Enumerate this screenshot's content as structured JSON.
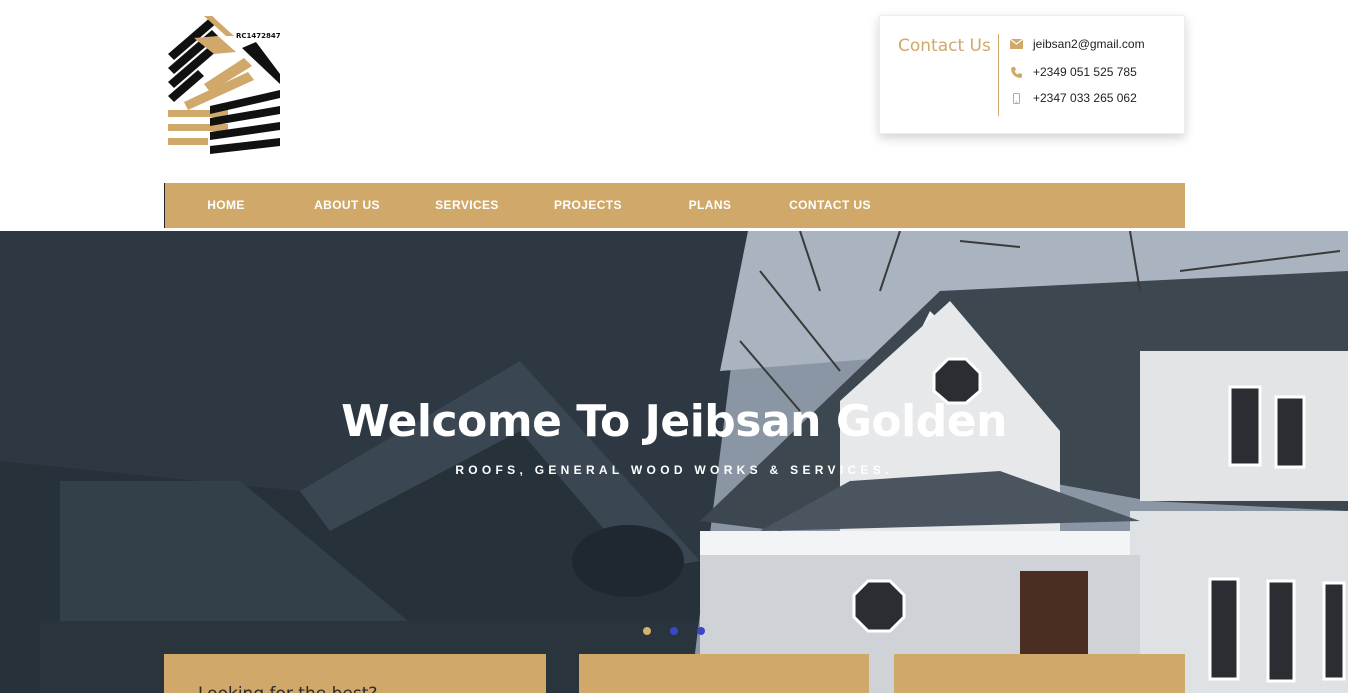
{
  "logo": {
    "text": "RC1472847"
  },
  "contact": {
    "title": "Contact Us",
    "email": "jeibsan2@gmail.com",
    "phone1": "+2349 051 525 785",
    "phone2": "+2347 033 265 062"
  },
  "nav": {
    "items": [
      "HOME",
      "ABOUT US",
      "SERVICES",
      "PROJECTS",
      "PLANS",
      "CONTACT US"
    ]
  },
  "hero": {
    "title": "Welcome To Jeibsan Golden",
    "subtitle": "ROOFS, GENERAL WOOD WORKS & SERVICES.",
    "slides": 3,
    "active_slide": 1
  },
  "feature_boxes": [
    {
      "text": "Looking for the best?"
    },
    {
      "text": ""
    },
    {
      "text": ""
    }
  ],
  "colors": {
    "accent": "#cfa86a",
    "dot_inactive": "#3a47c8"
  }
}
